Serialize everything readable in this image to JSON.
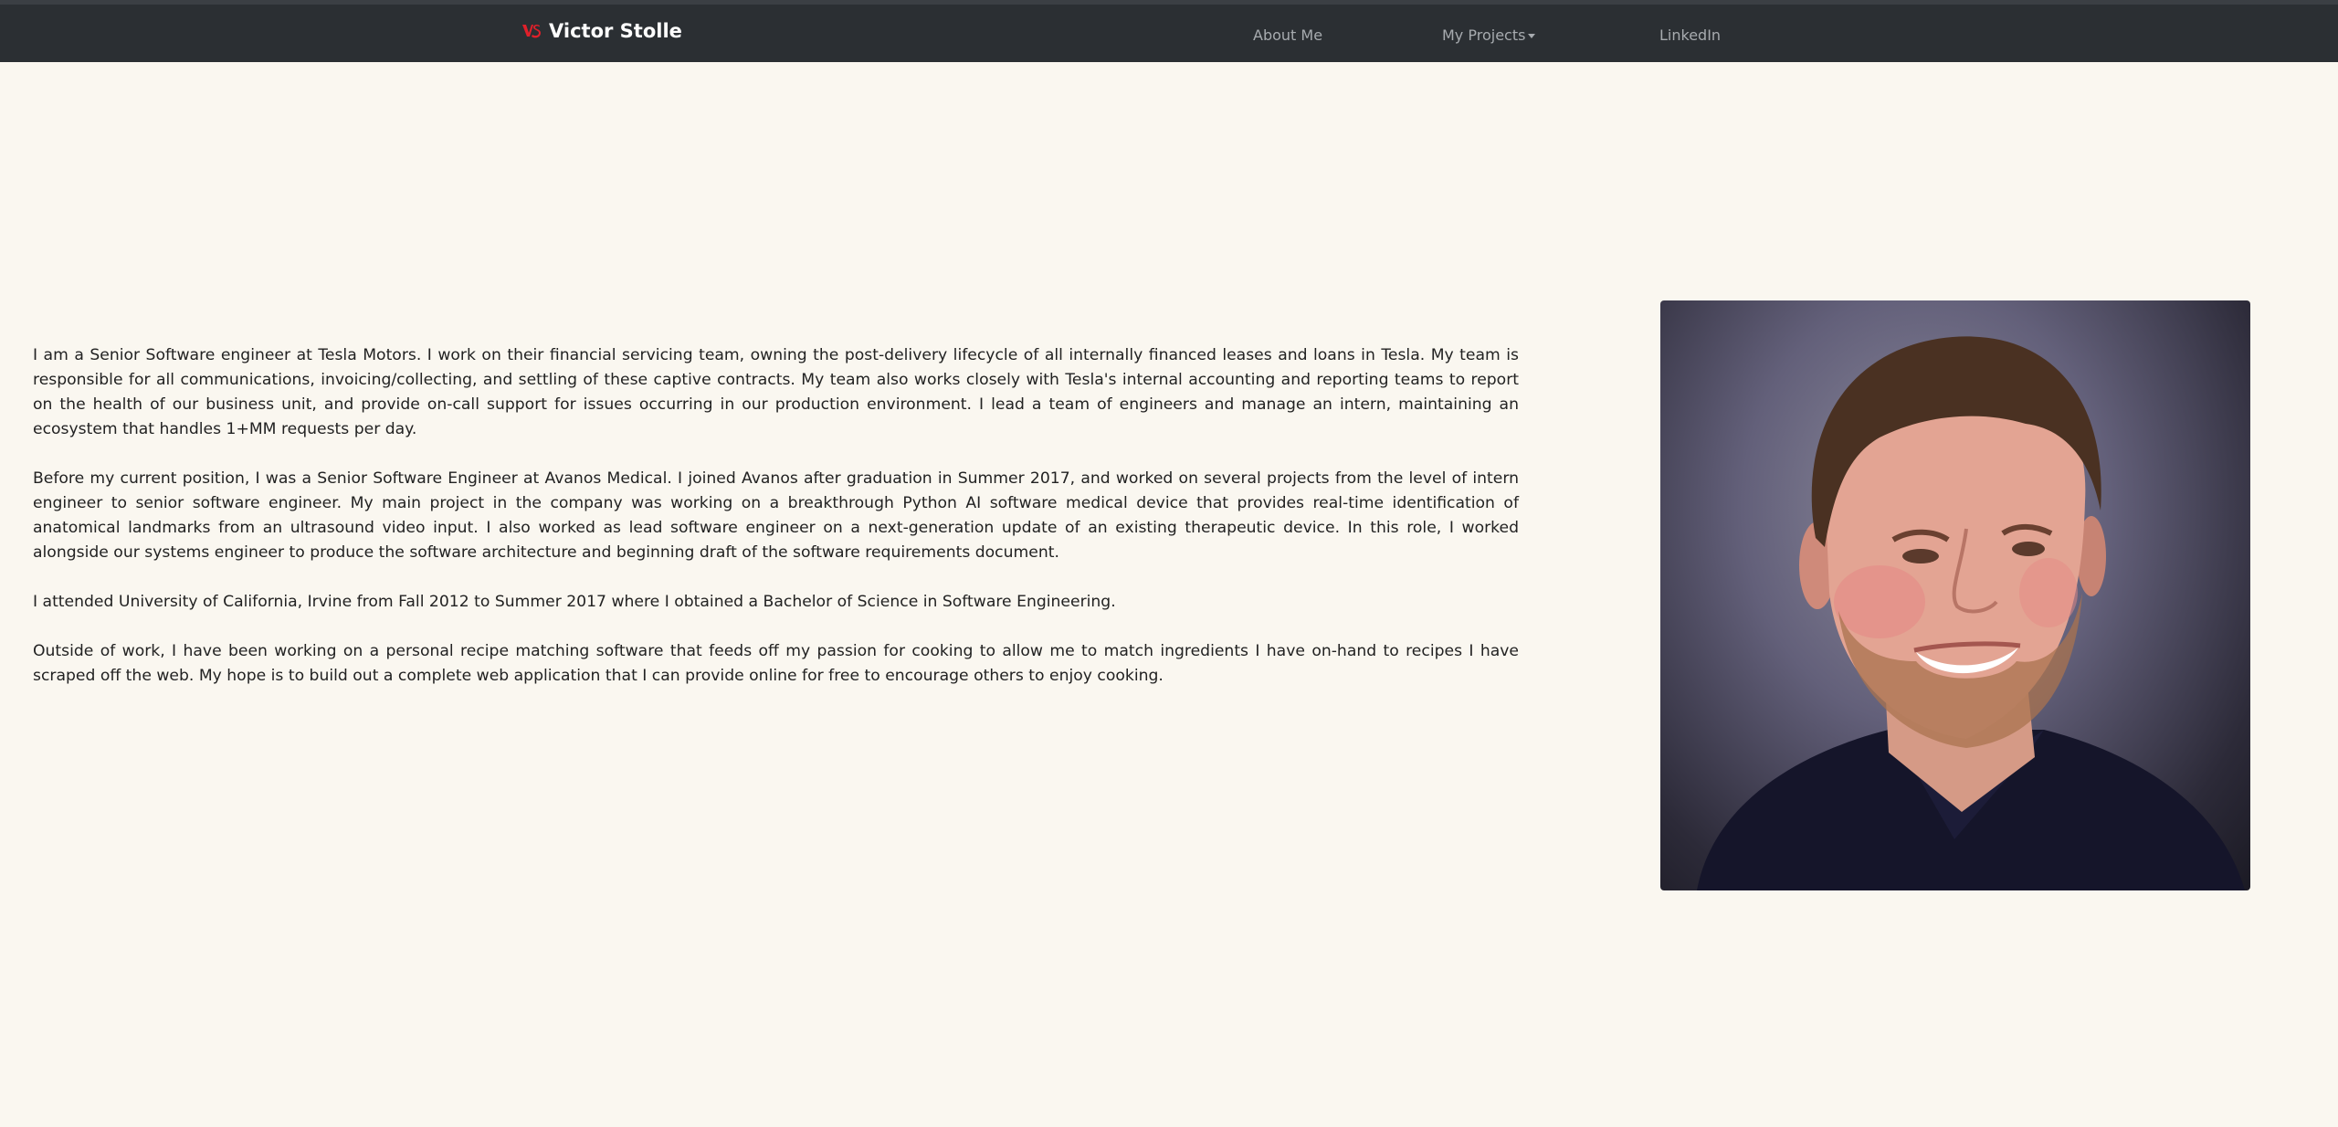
{
  "nav": {
    "brand_name": "Victor Stolle",
    "brand_icon": "vs-logo-icon",
    "links": {
      "about": "About Me",
      "projects": "My Projects",
      "linkedin": "LinkedIn"
    }
  },
  "colors": {
    "navbar_bg": "#2b2f33",
    "page_bg": "#faf7f0",
    "logo_red": "#e0202a"
  },
  "bio": {
    "paragraphs": [
      "I am a Senior Software engineer at Tesla Motors. I work on their financial servicing team, owning the post-delivery lifecycle of all internally financed leases and loans in Tesla. My team is responsible for all communications, invoicing/collecting, and settling of these captive contracts. My team also works closely with Tesla's internal accounting and reporting teams to report on the health of our business unit, and provide on-call support for issues occurring in our production environment. I lead a team of engineers and manage an intern, maintaining an ecosystem that handles 1+MM requests per day.",
      "Before my current position, I was a Senior Software Engineer at Avanos Medical. I joined Avanos after graduation in Summer 2017, and worked on several projects from the level of intern engineer to senior software engineer. My main project in the company was working on a breakthrough Python AI software medical device that provides real-time identification of anatomical landmarks from an ultrasound video input. I also worked as lead software engineer on a next-generation update of an existing therapeutic device. In this role, I worked alongside our systems engineer to produce the software architecture and beginning draft of the software requirements document.",
      "I attended University of California, Irvine from Fall 2012 to Summer 2017 where I obtained a Bachelor of Science in Software Engineering.",
      "Outside of work, I have been working on a personal recipe matching software that feeds off my passion for cooking to allow me to match ingredients I have on-hand to recipes I have scraped off the web. My hope is to build out a complete web application that I can provide online for free to encourage others to enjoy cooking."
    ]
  }
}
